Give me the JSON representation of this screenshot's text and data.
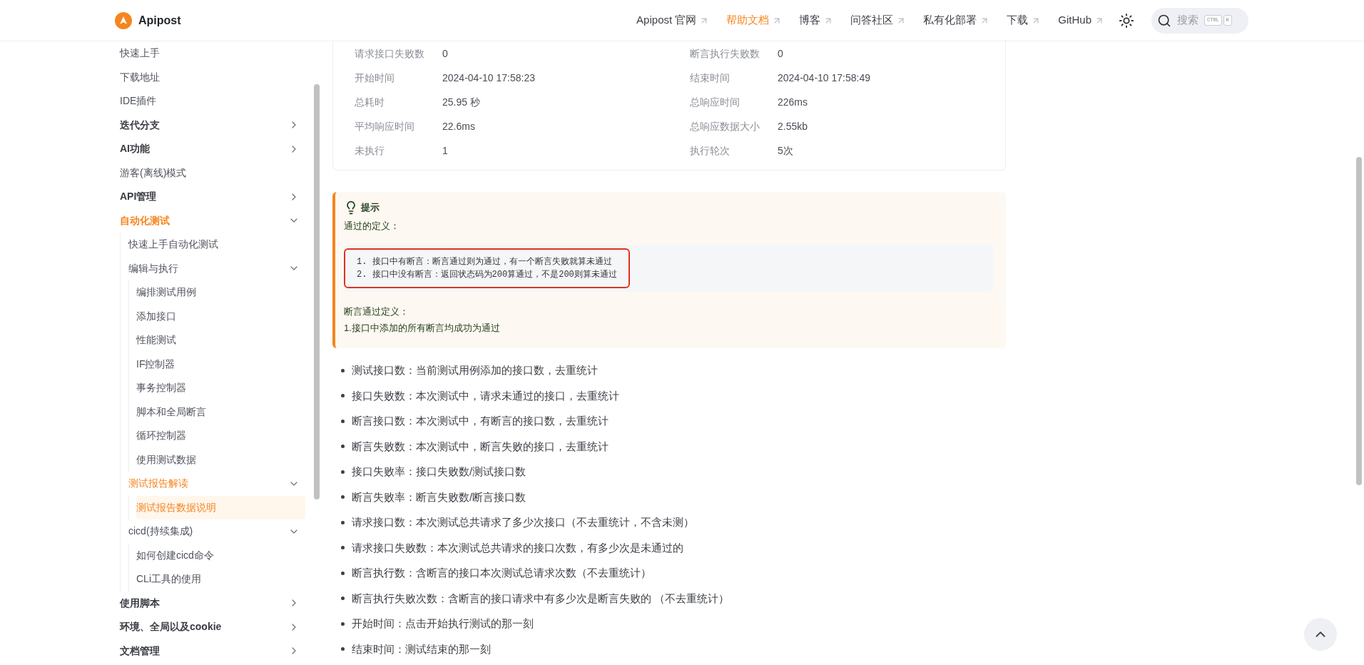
{
  "header": {
    "brand": "Apipost",
    "nav": [
      {
        "label": "Apipost 官网",
        "selected": false
      },
      {
        "label": "帮助文档",
        "selected": true
      },
      {
        "label": "博客",
        "selected": false
      },
      {
        "label": "问答社区",
        "selected": false
      },
      {
        "label": "私有化部署",
        "selected": false
      },
      {
        "label": "下载",
        "selected": false
      },
      {
        "label": "GitHub",
        "selected": false
      }
    ],
    "search": {
      "placeholder": "搜索",
      "keys": [
        "CTRL",
        "K"
      ]
    }
  },
  "sidebar": {
    "items": [
      {
        "label": "快速上手",
        "selected": false
      },
      {
        "label": "下载地址",
        "selected": false
      },
      {
        "label": "IDE插件",
        "selected": false
      },
      {
        "label": "迭代分支",
        "selected": false,
        "expanded": false
      },
      {
        "label": "AI功能",
        "selected": false,
        "expanded": false
      },
      {
        "label": "游客(离线)模式",
        "selected": false
      },
      {
        "label": "API管理",
        "selected": false,
        "expanded": false
      },
      {
        "label": "自动化测试",
        "selected": false,
        "expanded": true,
        "children": [
          {
            "label": "快速上手自动化测试",
            "selected": false
          },
          {
            "label": "编辑与执行",
            "selected": false,
            "expanded": true,
            "children": [
              {
                "label": "编排测试用例",
                "selected": false
              },
              {
                "label": "添加接口",
                "selected": false
              },
              {
                "label": "性能测试",
                "selected": false
              },
              {
                "label": "IF控制器",
                "selected": false
              },
              {
                "label": "事务控制器",
                "selected": false
              },
              {
                "label": "脚本和全局断言",
                "selected": false
              },
              {
                "label": "循环控制器",
                "selected": false
              },
              {
                "label": "使用测试数据",
                "selected": false
              }
            ]
          },
          {
            "label": "测试报告解读",
            "selected": false,
            "expanded": true,
            "children": [
              {
                "label": "测试报告数据说明",
                "selected": true
              }
            ]
          },
          {
            "label": "cicd(持续集成)",
            "selected": false,
            "expanded": true,
            "children": [
              {
                "label": "如何创建cicd命令",
                "selected": false
              },
              {
                "label": "CLi工具的使用",
                "selected": false
              }
            ]
          }
        ]
      },
      {
        "label": "使用脚本",
        "selected": false,
        "expanded": false
      },
      {
        "label": "环境、全局以及cookie",
        "selected": false,
        "expanded": false
      },
      {
        "label": "文档管理",
        "selected": false,
        "expanded": false
      }
    ]
  },
  "stats": [
    [
      {
        "label": "请求接口失败数",
        "value": "0"
      },
      {
        "label": "断言执行失败数",
        "value": "0"
      }
    ],
    [
      {
        "label": "开始时间",
        "value": "2024-04-10 17:58:23"
      },
      {
        "label": "结束时间",
        "value": "2024-04-10 17:58:49"
      }
    ],
    [
      {
        "label": "总耗时",
        "value": "25.95 秒"
      },
      {
        "label": "总响应时间",
        "value": "226ms"
      }
    ],
    [
      {
        "label": "平均响应时间",
        "value": "22.6ms"
      },
      {
        "label": "总响应数据大小",
        "value": "2.55kb"
      }
    ],
    [
      {
        "label": "未执行",
        "value": "1"
      },
      {
        "label": "执行轮次",
        "value": "5次"
      }
    ]
  ],
  "tip": {
    "title": "提示",
    "intro": "通过的定义：",
    "code": [
      "1. 接口中有断言：断言通过则为通过，有一个断言失败就算未通过",
      "2. 接口中没有断言：返回状态码为200算通过，不是200则算未通过"
    ],
    "subtitle": "断言通过定义：",
    "note": "1.接口中添加的所有断言均成功为通过"
  },
  "bullets": [
    "测试接口数：当前测试用例添加的接口数，去重统计",
    "接口失败数：本次测试中，请求未通过的接口，去重统计",
    "断言接口数：本次测试中，有断言的接口数，去重统计",
    "断言失败数：本次测试中，断言失败的接口，去重统计",
    "接口失败率：接口失败数/测试接口数",
    "断言失败率：断言失败数/断言接口数",
    "请求接口数：本次测试总共请求了多少次接口（不去重统计，不含未测）",
    "请求接口失败数：本次测试总共请求的接口次数，有多少次是未通过的",
    "断言执行数：含断言的接口本次测试总请求次数（不去重统计）",
    "断言执行失败次数：含断言的接口请求中有多少次是断言失败的 （不去重统计）",
    "开始时间：点击开始执行测试的那一刻",
    "结束时间：测试结束的那一刻"
  ]
}
